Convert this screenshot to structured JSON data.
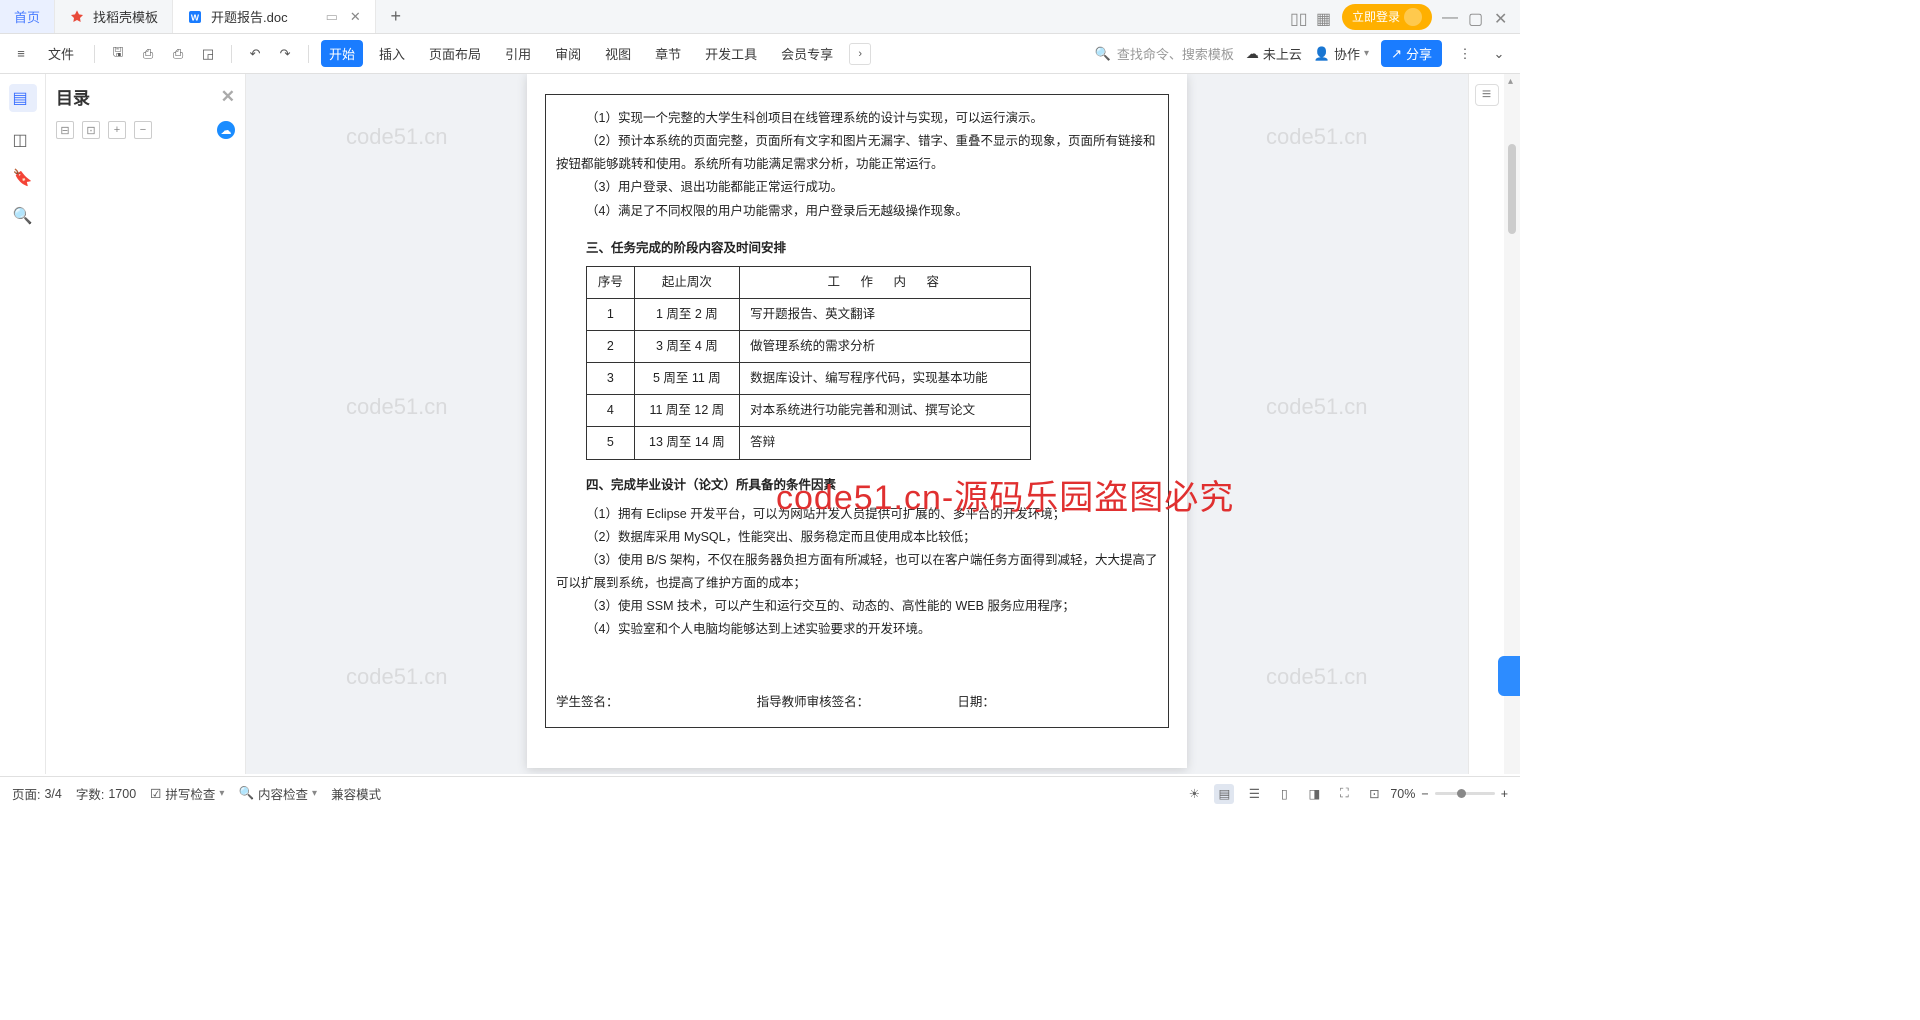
{
  "tabs": {
    "home": "首页",
    "template": "找稻壳模板",
    "doc": "开题报告.doc"
  },
  "login": "立即登录",
  "menu": {
    "file": "文件"
  },
  "ribbon": {
    "start": "开始",
    "insert": "插入",
    "layout": "页面布局",
    "ref": "引用",
    "review": "审阅",
    "view": "视图",
    "chapter": "章节",
    "dev": "开发工具",
    "vip": "会员专享"
  },
  "search_placeholder": "查找命令、搜索模板",
  "cloud": "未上云",
  "collab": "协作",
  "share": "分享",
  "toc_title": "目录",
  "doc": {
    "p1": "（1）实现一个完整的大学生科创项目在线管理系统的设计与实现，可以运行演示。",
    "p2": "（2）预计本系统的页面完整，页面所有文字和图片无漏字、错字、重叠不显示的现象，页面所有链接和按钮都能够跳转和使用。系统所有功能满足需求分析，功能正常运行。",
    "p3": "（3）用户登录、退出功能都能正常运行成功。",
    "p4": "（4）满足了不同权限的用户功能需求，用户登录后无越级操作现象。",
    "h3_3": "三、任务完成的阶段内容及时间安排",
    "th1": "序号",
    "th2": "起止周次",
    "th3": "工　作　内　容",
    "rows": [
      {
        "n": "1",
        "w": "1 周至 2 周",
        "c": "写开题报告、英文翻译"
      },
      {
        "n": "2",
        "w": "3 周至 4 周",
        "c": "做管理系统的需求分析"
      },
      {
        "n": "3",
        "w": "5 周至 11 周",
        "c": "数据库设计、编写程序代码，实现基本功能"
      },
      {
        "n": "4",
        "w": "11 周至 12 周",
        "c": "对本系统进行功能完善和测试、撰写论文"
      },
      {
        "n": "5",
        "w": "13 周至 14 周",
        "c": "答辩"
      }
    ],
    "h3_4": "四、完成毕业设计（论文）所具备的条件因素",
    "q1": "（1）拥有 Eclipse 开发平台，可以为网站开发人员提供可扩展的、多平台的开发环境；",
    "q2": "（2）数据库采用 MySQL，性能突出、服务稳定而且使用成本比较低；",
    "q3": "（3）使用 B/S 架构，不仅在服务器负担方面有所减轻，也可以在客户端任务方面得到减轻，大大提高了可以扩展到系统，也提高了维护方面的成本；",
    "q4": "（3）使用 SSM 技术，可以产生和运行交互的、动态的、高性能的 WEB 服务应用程序；",
    "q5": "（4）实验室和个人电脑均能够达到上述实验要求的开发环境。",
    "sig1": "学生签名：",
    "sig2": "指导教师审核签名：",
    "sig3": "日期："
  },
  "watermark": "code51.cn",
  "watermark_red": "code51.cn-源码乐园盗图必究",
  "status": {
    "page_lbl": "页面:",
    "page": "3/4",
    "words_lbl": "字数:",
    "words": "1700",
    "spell": "拼写检查",
    "content": "内容检查",
    "compat": "兼容模式",
    "zoom": "70%"
  }
}
